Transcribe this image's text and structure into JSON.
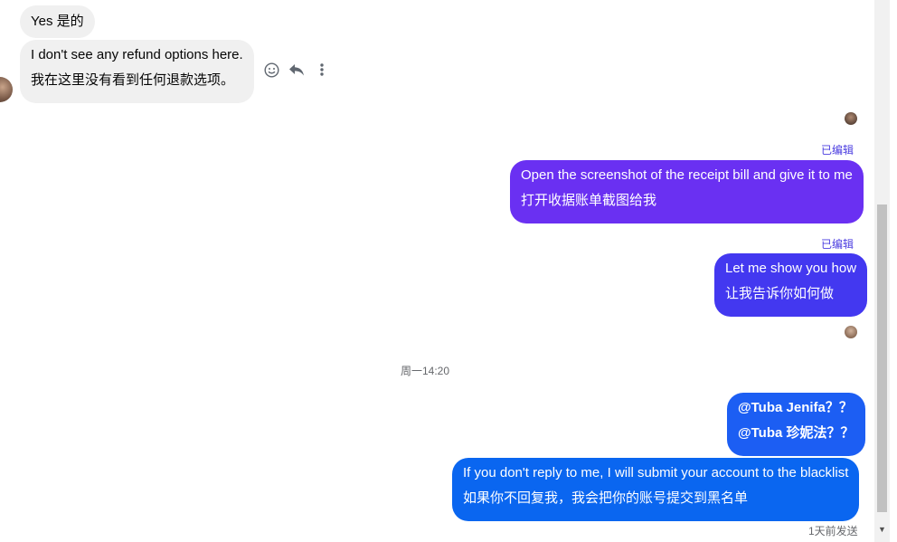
{
  "messages_incoming": [
    {
      "id": "yes",
      "lines": [
        "Yes  是的"
      ]
    },
    {
      "id": "refund",
      "lines": [
        "I don't see any refund options here.",
        "我在这里没有看到任何退款选项。"
      ]
    }
  ],
  "messages_outgoing": [
    {
      "id": "receipt",
      "edited_label": "已编辑",
      "lines": [
        "Open the screenshot of the receipt bill and give it to me",
        "打开收据账单截图给我"
      ]
    },
    {
      "id": "show",
      "edited_label": "已编辑",
      "lines": [
        "Let me show you how",
        "让我告诉你如何做"
      ]
    },
    {
      "id": "mention",
      "lines": [
        "@Tuba Jenifa？？",
        "@Tuba 珍妮法？？"
      ]
    },
    {
      "id": "blacklist",
      "lines": [
        "If you don't reply to me, I will submit your account to the blacklist",
        "如果你不回复我，我会把你的账号提交到黑名单"
      ]
    }
  ],
  "divider_time": "周一14:20",
  "sent_status": "1天前发送",
  "message_actions": {
    "react_icon": "smiley-icon",
    "reply_icon": "reply-icon",
    "more_icon": "more-vertical-icon"
  },
  "colors": {
    "purple": "#6b2ff5",
    "indigo": "#3b3df0",
    "blue": "#0a64f0",
    "incoming_bg": "#f0f0f0",
    "edited": "#4a3ce0"
  }
}
